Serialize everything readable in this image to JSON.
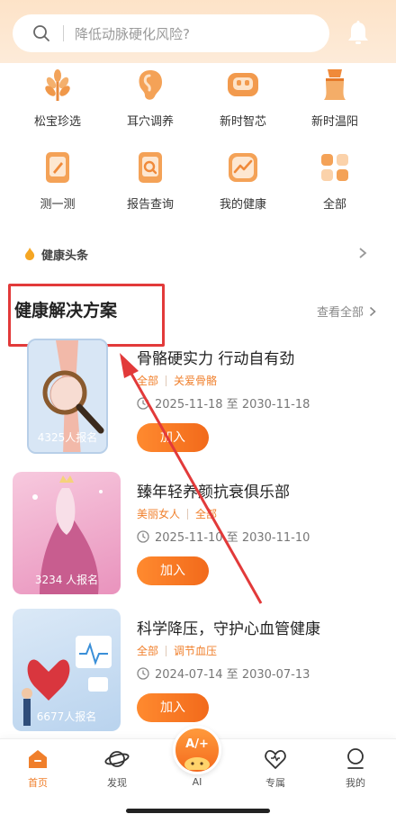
{
  "search": {
    "placeholder": "降低动脉硬化风险?"
  },
  "grid": [
    {
      "label": "松宝珍选",
      "icon": "wheat-icon"
    },
    {
      "label": "耳穴调养",
      "icon": "ear-icon"
    },
    {
      "label": "新时智芯",
      "icon": "chip-icon"
    },
    {
      "label": "新时温阳",
      "icon": "moxa-icon"
    },
    {
      "label": "测一测",
      "icon": "quiz-icon"
    },
    {
      "label": "报告查询",
      "icon": "report-icon"
    },
    {
      "label": "我的健康",
      "icon": "health-chart-icon"
    },
    {
      "label": "全部",
      "icon": "all-grid-icon"
    }
  ],
  "news": {
    "title": "健康头条"
  },
  "section": {
    "title": "健康解决方案",
    "see_all": "查看全部"
  },
  "cards": [
    {
      "title": "骨骼硬实力 行动自有劲",
      "tag1": "全部",
      "tag2": "关爱骨骼",
      "date": "2025-11-18 至 2030-11-18",
      "count": "4325人报名",
      "join": "加入"
    },
    {
      "title": "臻年轻养颜抗衰俱乐部",
      "tag1": "美丽女人",
      "tag2": "全部",
      "date": "2025-11-10 至 2030-11-10",
      "count": "3234 人报名",
      "join": "加入"
    },
    {
      "title": "科学降压，守护心血管健康",
      "tag1": "全部",
      "tag2": "调节血压",
      "date": "2024-07-14 至 2030-07-13",
      "count": "6677人报名",
      "join": "加入"
    }
  ],
  "tabs": {
    "home": "首页",
    "discover": "发现",
    "ai": "AI",
    "ai_badge": "A/+",
    "exclusive": "专属",
    "mine": "我的"
  },
  "colors": {
    "accent": "#f07f2b",
    "highlight": "#e23a3a"
  }
}
